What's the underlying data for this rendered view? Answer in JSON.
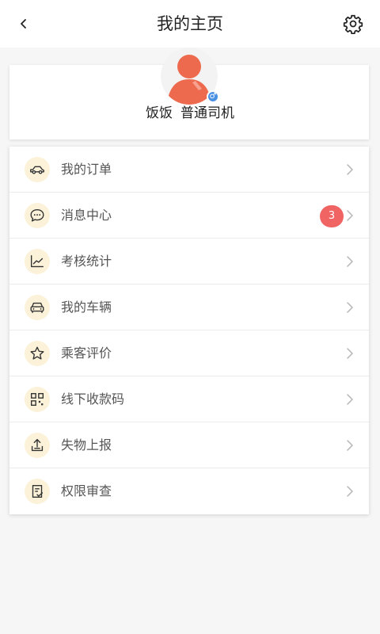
{
  "header": {
    "title": "我的主页"
  },
  "profile": {
    "name": "饭饭",
    "role": "普通司机",
    "gender_symbol": "♂"
  },
  "menu": {
    "items": [
      {
        "label": "我的订单",
        "icon": "car-icon"
      },
      {
        "label": "消息中心",
        "icon": "chat-icon",
        "badge": "3"
      },
      {
        "label": "考核统计",
        "icon": "chart-icon"
      },
      {
        "label": "我的车辆",
        "icon": "vehicle-icon"
      },
      {
        "label": "乘客评价",
        "icon": "star-icon"
      },
      {
        "label": "线下收款码",
        "icon": "qr-code-icon"
      },
      {
        "label": "失物上报",
        "icon": "upload-icon"
      },
      {
        "label": "权限审查",
        "icon": "document-check-icon"
      }
    ]
  },
  "colors": {
    "avatar": "#ee6a4f",
    "icon_bg": "#fbf2d9",
    "badge": "#f06464",
    "gender_badge": "#4a90e2"
  }
}
